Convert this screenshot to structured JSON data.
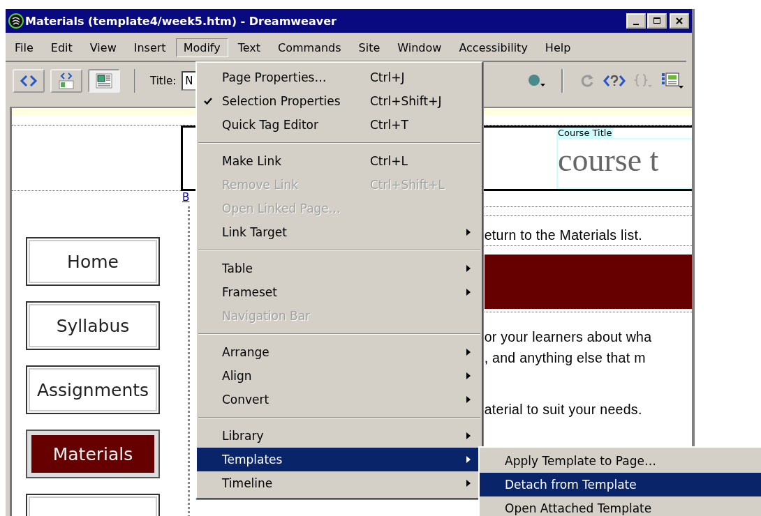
{
  "window": {
    "title": "Materials (template4/week5.htm) - Dreamweaver"
  },
  "menu_bar": [
    {
      "label": "File",
      "selected": false
    },
    {
      "label": "Edit",
      "selected": false
    },
    {
      "label": "View",
      "selected": false
    },
    {
      "label": "Insert",
      "selected": false
    },
    {
      "label": "Modify",
      "selected": true
    },
    {
      "label": "Text",
      "selected": false
    },
    {
      "label": "Commands",
      "selected": false
    },
    {
      "label": "Site",
      "selected": false
    },
    {
      "label": "Window",
      "selected": false
    },
    {
      "label": "Accessibility",
      "selected": false
    },
    {
      "label": "Help",
      "selected": false
    }
  ],
  "toolbar": {
    "title_label": "Title:",
    "title_value": "N"
  },
  "document": {
    "course_title_label": "Course Title",
    "course_title": "course t",
    "link": "B",
    "text_lines": [
      "eturn to the Materials list.",
      "or your learners about wha",
      ", and anything else that m",
      "aterial to suit your needs."
    ],
    "nav_buttons": [
      {
        "label": "Home",
        "selected": false
      },
      {
        "label": "Syllabus",
        "selected": false
      },
      {
        "label": "Assignments",
        "selected": false
      },
      {
        "label": "Materials",
        "selected": true
      }
    ]
  },
  "modify_menu": {
    "groups": [
      [
        {
          "label": "Page Properties…",
          "shortcut": "Ctrl+J",
          "checked": false,
          "disabled": false,
          "submenu": false,
          "selected": false
        },
        {
          "label": "Selection Properties",
          "shortcut": "Ctrl+Shift+J",
          "checked": true,
          "disabled": false,
          "submenu": false,
          "selected": false
        },
        {
          "label": "Quick Tag Editor",
          "shortcut": "Ctrl+T",
          "checked": false,
          "disabled": false,
          "submenu": false,
          "selected": false
        }
      ],
      [
        {
          "label": "Make Link",
          "shortcut": "Ctrl+L",
          "checked": false,
          "disabled": false,
          "submenu": false,
          "selected": false
        },
        {
          "label": "Remove Link",
          "shortcut": "Ctrl+Shift+L",
          "checked": false,
          "disabled": true,
          "submenu": false,
          "selected": false
        },
        {
          "label": "Open Linked Page…",
          "checked": false,
          "disabled": true,
          "submenu": false,
          "selected": false
        },
        {
          "label": "Link Target",
          "checked": false,
          "disabled": false,
          "submenu": true,
          "selected": false
        }
      ],
      [
        {
          "label": "Table",
          "checked": false,
          "disabled": false,
          "submenu": true,
          "selected": false
        },
        {
          "label": "Frameset",
          "checked": false,
          "disabled": false,
          "submenu": true,
          "selected": false
        },
        {
          "label": "Navigation Bar",
          "checked": false,
          "disabled": true,
          "submenu": false,
          "selected": false
        }
      ],
      [
        {
          "label": "Arrange",
          "checked": false,
          "disabled": false,
          "submenu": true,
          "selected": false
        },
        {
          "label": "Align",
          "checked": false,
          "disabled": false,
          "submenu": true,
          "selected": false
        },
        {
          "label": "Convert",
          "checked": false,
          "disabled": false,
          "submenu": true,
          "selected": false
        }
      ],
      [
        {
          "label": "Library",
          "checked": false,
          "disabled": false,
          "submenu": true,
          "selected": false
        },
        {
          "label": "Templates",
          "checked": false,
          "disabled": false,
          "submenu": true,
          "selected": true
        },
        {
          "label": "Timeline",
          "checked": false,
          "disabled": false,
          "submenu": true,
          "selected": false
        }
      ]
    ]
  },
  "templates_submenu": {
    "items": [
      {
        "label": "Apply Template to Page…",
        "selected": false
      },
      {
        "label": "Detach from Template",
        "selected": true
      },
      {
        "label": "Open Attached Template",
        "selected": false
      }
    ]
  }
}
